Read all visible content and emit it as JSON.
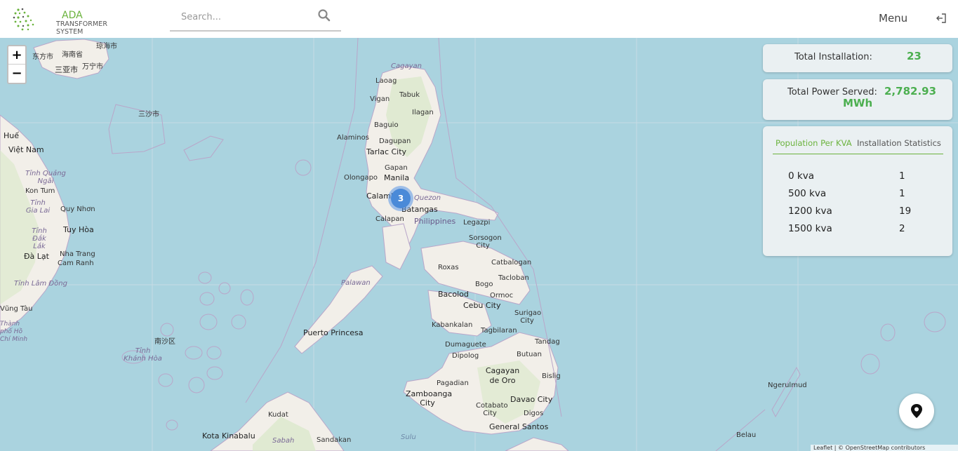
{
  "app": {
    "logo_title": "ADA",
    "logo_subtitle": "TRANSFORMER SYSTEM"
  },
  "search": {
    "placeholder": "Search..."
  },
  "header": {
    "menu_label": "Menu",
    "icons": [
      "search-icon",
      "logout-icon"
    ]
  },
  "map": {
    "zoom_in": "+",
    "zoom_out": "−",
    "cluster_count": "3",
    "attribution": "Leaflet | © OpenStreetMap contributors",
    "labels": [
      "东方市",
      "海南省",
      "琼海市",
      "三亚市",
      "万宁市",
      "三沙市",
      "Huế",
      "Việt Nam",
      "Tỉnh Quảng Ngãi",
      "Kon Tum",
      "Tỉnh Gia Lai",
      "Quy Nhơn",
      "Tỉnh Đắk Lắk",
      "Tuy Hòa",
      "Đà Lạt",
      "Nha Trang",
      "Cam Ranh",
      "Tỉnh Lâm Đồng",
      "Vũng Tàu",
      "Thành phố Hồ Chí Minh",
      "南沙区",
      "Tỉnh Khánh Hòa",
      "Cagayan",
      "Laoag",
      "Tabuk",
      "Vigan",
      "Ilagan",
      "Baguio",
      "Alaminos",
      "Dagupan",
      "Tarlac City",
      "Gapan",
      "Olongapo",
      "Manila",
      "Calamba",
      "Quezon",
      "Batangas",
      "Calapan",
      "Philippines",
      "Legazpi",
      "Sorsogon City",
      "Catbalogan",
      "Roxas",
      "Tacloban",
      "Palawan",
      "Bogo",
      "Bacolod",
      "Ormoc",
      "Cebu City",
      "Surigao City",
      "Kabankalan",
      "Tagbilaran",
      "Puerto Princesa",
      "Tandag",
      "Dumaguete",
      "Butuan",
      "Dipolog",
      "Cagayan de Oro",
      "Bislig",
      "Pagadian",
      "Zamboanga City",
      "Davao City",
      "Cotabato City",
      "Digos",
      "Kudat",
      "General Santos",
      "Ngerulmud",
      "Kota Kinabalu",
      "Sabah",
      "Sandakan",
      "Sulu",
      "Belau"
    ]
  },
  "stats": {
    "total_installation_label": "Total Installation:",
    "total_installation_value": "23",
    "total_power_label": "Total Power Served:",
    "total_power_value": "2,782.93",
    "total_power_unit": "MWh"
  },
  "tabs": [
    {
      "label": "Population Per KVA",
      "active": true
    },
    {
      "label": "Installation Statistics",
      "active": false
    }
  ],
  "kva_rows": [
    {
      "label": "0 kva",
      "value": "1"
    },
    {
      "label": "500 kva",
      "value": "1"
    },
    {
      "label": "1200 kva",
      "value": "19"
    },
    {
      "label": "1500 kva",
      "value": "2"
    }
  ],
  "colors": {
    "accent_green": "#6bb33d",
    "value_green": "#4caf50",
    "water": "#aad3df",
    "land": "#f2efe9",
    "cluster": "#4a8ad8"
  }
}
